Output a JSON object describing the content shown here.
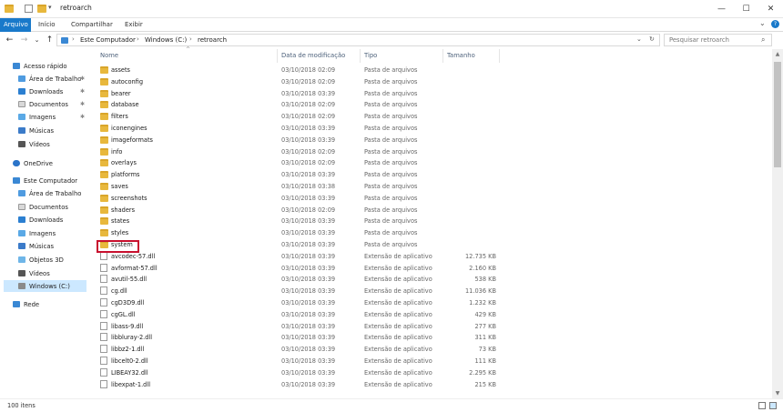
{
  "window": {
    "title": "retroarch",
    "minimize": "—",
    "maximize": "☐",
    "close": "✕",
    "qa_dropdown": "▾"
  },
  "ribbon": {
    "tabs": [
      "Arquivo",
      "Início",
      "Compartilhar",
      "Exibir"
    ],
    "expand": "⌄",
    "help": "?"
  },
  "address": {
    "back": "←",
    "forward": "→",
    "recent": "⌄",
    "up": "↑",
    "crumbs": [
      "Este Computador",
      "Windows (C:)",
      "retroarch"
    ],
    "separator": "›",
    "dropdown": "⌄",
    "refresh": "↻",
    "search_placeholder": "Pesquisar retroarch",
    "search_icon": "⌕"
  },
  "nav": {
    "quick_access": "Acesso rápido",
    "quick_items": [
      "Área de Trabalho",
      "Downloads",
      "Documentos",
      "Imagens",
      "Músicas",
      "Vídeos"
    ],
    "pin_icon": "✱",
    "onedrive": "OneDrive",
    "this_pc": "Este Computador",
    "pc_items": [
      "Área de Trabalho",
      "Documentos",
      "Downloads",
      "Imagens",
      "Músicas",
      "Objetos 3D",
      "Vídeos",
      "Windows (C:)"
    ],
    "network": "Rede",
    "expander": "›"
  },
  "list": {
    "sort_caret": "^",
    "headers": {
      "name": "Nome",
      "date": "Data de modificação",
      "type": "Tipo",
      "size": "Tamanho"
    },
    "rows": [
      {
        "name": "assets",
        "date": "03/10/2018 02:09",
        "type": "Pasta de arquivos",
        "size": "",
        "kind": "folder"
      },
      {
        "name": "autoconfig",
        "date": "03/10/2018 02:09",
        "type": "Pasta de arquivos",
        "size": "",
        "kind": "folder"
      },
      {
        "name": "bearer",
        "date": "03/10/2018 03:39",
        "type": "Pasta de arquivos",
        "size": "",
        "kind": "folder"
      },
      {
        "name": "database",
        "date": "03/10/2018 02:09",
        "type": "Pasta de arquivos",
        "size": "",
        "kind": "folder"
      },
      {
        "name": "filters",
        "date": "03/10/2018 02:09",
        "type": "Pasta de arquivos",
        "size": "",
        "kind": "folder"
      },
      {
        "name": "iconengines",
        "date": "03/10/2018 03:39",
        "type": "Pasta de arquivos",
        "size": "",
        "kind": "folder"
      },
      {
        "name": "imageformats",
        "date": "03/10/2018 03:39",
        "type": "Pasta de arquivos",
        "size": "",
        "kind": "folder"
      },
      {
        "name": "info",
        "date": "03/10/2018 02:09",
        "type": "Pasta de arquivos",
        "size": "",
        "kind": "folder"
      },
      {
        "name": "overlays",
        "date": "03/10/2018 02:09",
        "type": "Pasta de arquivos",
        "size": "",
        "kind": "folder"
      },
      {
        "name": "platforms",
        "date": "03/10/2018 03:39",
        "type": "Pasta de arquivos",
        "size": "",
        "kind": "folder"
      },
      {
        "name": "saves",
        "date": "03/10/2018 03:38",
        "type": "Pasta de arquivos",
        "size": "",
        "kind": "folder"
      },
      {
        "name": "screenshots",
        "date": "03/10/2018 03:39",
        "type": "Pasta de arquivos",
        "size": "",
        "kind": "folder"
      },
      {
        "name": "shaders",
        "date": "03/10/2018 02:09",
        "type": "Pasta de arquivos",
        "size": "",
        "kind": "folder"
      },
      {
        "name": "states",
        "date": "03/10/2018 03:39",
        "type": "Pasta de arquivos",
        "size": "",
        "kind": "folder"
      },
      {
        "name": "styles",
        "date": "03/10/2018 03:39",
        "type": "Pasta de arquivos",
        "size": "",
        "kind": "folder"
      },
      {
        "name": "system",
        "date": "03/10/2018 03:39",
        "type": "Pasta de arquivos",
        "size": "",
        "kind": "folder"
      },
      {
        "name": "avcodec-57.dll",
        "date": "03/10/2018 03:39",
        "type": "Extensão de aplicativo",
        "size": "12.735 KB",
        "kind": "dll"
      },
      {
        "name": "avformat-57.dll",
        "date": "03/10/2018 03:39",
        "type": "Extensão de aplicativo",
        "size": "2.160 KB",
        "kind": "dll"
      },
      {
        "name": "avutil-55.dll",
        "date": "03/10/2018 03:39",
        "type": "Extensão de aplicativo",
        "size": "538 KB",
        "kind": "dll"
      },
      {
        "name": "cg.dll",
        "date": "03/10/2018 03:39",
        "type": "Extensão de aplicativo",
        "size": "11.036 KB",
        "kind": "dll"
      },
      {
        "name": "cgD3D9.dll",
        "date": "03/10/2018 03:39",
        "type": "Extensão de aplicativo",
        "size": "1.232 KB",
        "kind": "dll"
      },
      {
        "name": "cgGL.dll",
        "date": "03/10/2018 03:39",
        "type": "Extensão de aplicativo",
        "size": "429 KB",
        "kind": "dll"
      },
      {
        "name": "libass-9.dll",
        "date": "03/10/2018 03:39",
        "type": "Extensão de aplicativo",
        "size": "277 KB",
        "kind": "dll"
      },
      {
        "name": "libbluray-2.dll",
        "date": "03/10/2018 03:39",
        "type": "Extensão de aplicativo",
        "size": "311 KB",
        "kind": "dll"
      },
      {
        "name": "libbz2-1.dll",
        "date": "03/10/2018 03:39",
        "type": "Extensão de aplicativo",
        "size": "73 KB",
        "kind": "dll"
      },
      {
        "name": "libcelt0-2.dll",
        "date": "03/10/2018 03:39",
        "type": "Extensão de aplicativo",
        "size": "111 KB",
        "kind": "dll"
      },
      {
        "name": "LIBEAY32.dll",
        "date": "03/10/2018 03:39",
        "type": "Extensão de aplicativo",
        "size": "2.295 KB",
        "kind": "dll"
      },
      {
        "name": "libexpat-1.dll",
        "date": "03/10/2018 03:39",
        "type": "Extensão de aplicativo",
        "size": "215 KB",
        "kind": "dll"
      }
    ]
  },
  "scroll": {
    "up": "▲",
    "down": "▼"
  },
  "status": {
    "items": "100 itens"
  },
  "colors": {
    "accent": "#1979ca",
    "highlight": "#c8102e",
    "folder": "#e8b83d",
    "selection": "#cce8ff"
  }
}
